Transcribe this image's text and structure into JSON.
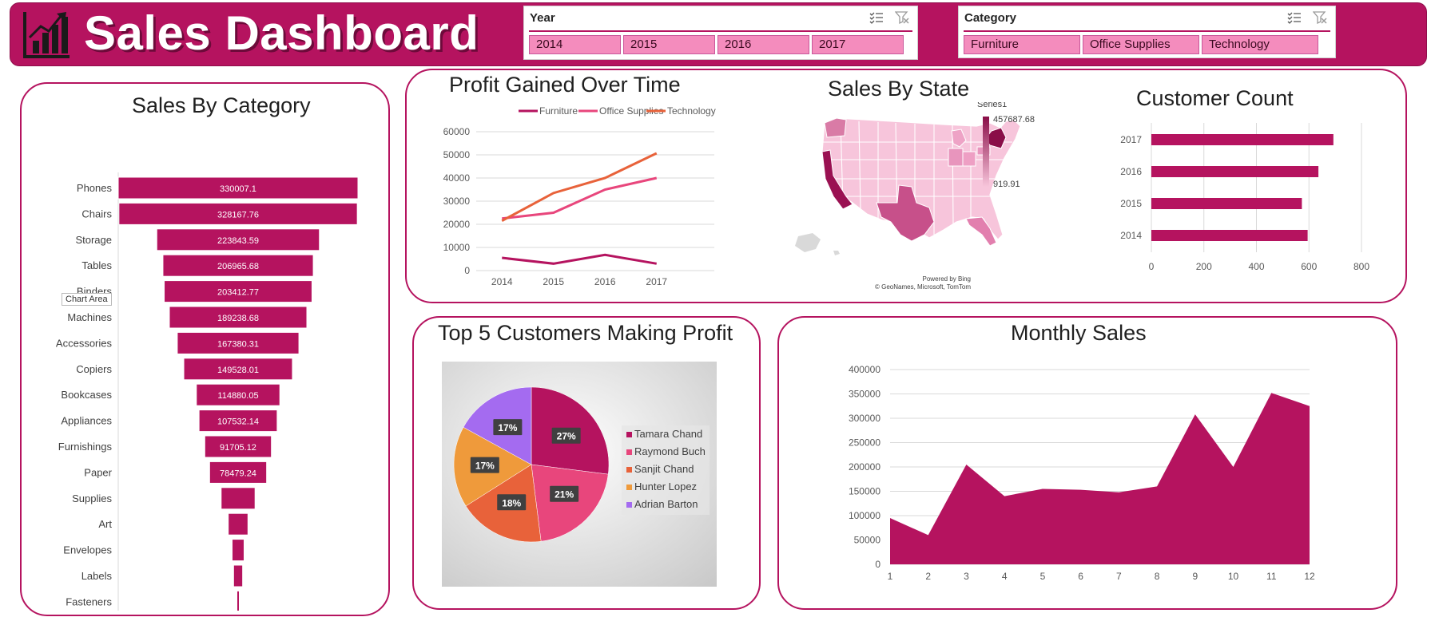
{
  "header": {
    "title": "Sales Dashboard",
    "logo_icon": "bar-chart-growth-icon",
    "background": "#b5135f"
  },
  "slicers": {
    "year": {
      "title": "Year",
      "items": [
        "2014",
        "2015",
        "2016",
        "2017"
      ],
      "multi_select_icon": "multi-select-icon",
      "clear_filter_icon": "clear-filter-icon"
    },
    "category": {
      "title": "Category",
      "items": [
        "Furniture",
        "Office Supplies",
        "Technology"
      ],
      "multi_select_icon": "multi-select-icon",
      "clear_filter_icon": "clear-filter-icon"
    }
  },
  "tooltip": {
    "text": "Chart Area"
  },
  "colors": {
    "primary": "#b5135f",
    "magenta": "#d81e74",
    "pink": "#e8467c",
    "orange": "#e8623a",
    "amber": "#ef9a3b",
    "purple": "#a46bf0"
  },
  "map": {
    "title": "Sales By State",
    "legend_series": "Series1",
    "legend_max": "457687.68",
    "legend_min": "919.91",
    "attribution_1": "Powered by Bing",
    "attribution_2": "© GeoNames, Microsoft, TomTom"
  },
  "chart_data": [
    {
      "id": "sales-by-category",
      "type": "bar",
      "title": "Sales By Category",
      "orientation": "horizontal-funnel",
      "categories": [
        "Phones",
        "Chairs",
        "Storage",
        "Tables",
        "Binders",
        "Machines",
        "Accessories",
        "Copiers",
        "Bookcases",
        "Appliances",
        "Furnishings",
        "Paper",
        "Supplies",
        "Art",
        "Envelopes",
        "Labels",
        "Fasteners"
      ],
      "values": [
        330007.1,
        328167.76,
        223843.59,
        206965.68,
        203412.77,
        189238.68,
        167380.31,
        149528.01,
        114880.05,
        107532.14,
        91705.12,
        78479.24,
        46673.54,
        27118.79,
        16476.4,
        12486.31,
        3024.28
      ],
      "labels": [
        "330007.1",
        "328167.76",
        "223843.59",
        "206965.68",
        "203412.77",
        "189238.68",
        "167380.31",
        "149528.01",
        "114880.05",
        "107532.14",
        "91705.12",
        "78479.24",
        "",
        "",
        "",
        "",
        ""
      ]
    },
    {
      "id": "profit-over-time",
      "type": "line",
      "title": "Profit Gained Over Time",
      "x": [
        "2014",
        "2015",
        "2016",
        "2017"
      ],
      "series": [
        {
          "name": "Furniture",
          "values": [
            5500,
            3000,
            6800,
            3000
          ]
        },
        {
          "name": "Office Supplies",
          "values": [
            22500,
            25000,
            35000,
            40000
          ]
        },
        {
          "name": "Technology",
          "values": [
            21500,
            33500,
            40000,
            50700
          ]
        }
      ],
      "ylim": [
        0,
        60000
      ],
      "yticks": [
        "0",
        "10000",
        "20000",
        "30000",
        "40000",
        "50000",
        "60000"
      ],
      "legend": "top"
    },
    {
      "id": "customer-count",
      "type": "bar",
      "title": "Customer Count",
      "orientation": "horizontal",
      "categories": [
        "2017",
        "2016",
        "2015",
        "2014"
      ],
      "values": [
        693,
        636,
        573,
        595
      ],
      "xlim": [
        0,
        800
      ],
      "xticks": [
        "0",
        "200",
        "400",
        "600",
        "800"
      ]
    },
    {
      "id": "top-5-customers",
      "type": "pie",
      "title": "Top 5 Customers Making Profit",
      "categories": [
        "Tamara Chand",
        "Raymond Buch",
        "Sanjit Chand",
        "Hunter Lopez",
        "Adrian Barton"
      ],
      "values": [
        27,
        21,
        18,
        17,
        17
      ],
      "labels": [
        "27%",
        "21%",
        "18%",
        "17%",
        "17%"
      ],
      "legend": "right"
    },
    {
      "id": "monthly-sales",
      "type": "area",
      "title": "Monthly Sales",
      "x": [
        "1",
        "2",
        "3",
        "4",
        "5",
        "6",
        "7",
        "8",
        "9",
        "10",
        "11",
        "12"
      ],
      "values": [
        95000,
        60000,
        205000,
        140000,
        155000,
        153000,
        148000,
        160000,
        308000,
        200000,
        352000,
        325000
      ],
      "ylim": [
        0,
        400000
      ],
      "yticks": [
        "0",
        "50000",
        "100000",
        "150000",
        "200000",
        "250000",
        "300000",
        "350000",
        "400000"
      ]
    }
  ]
}
